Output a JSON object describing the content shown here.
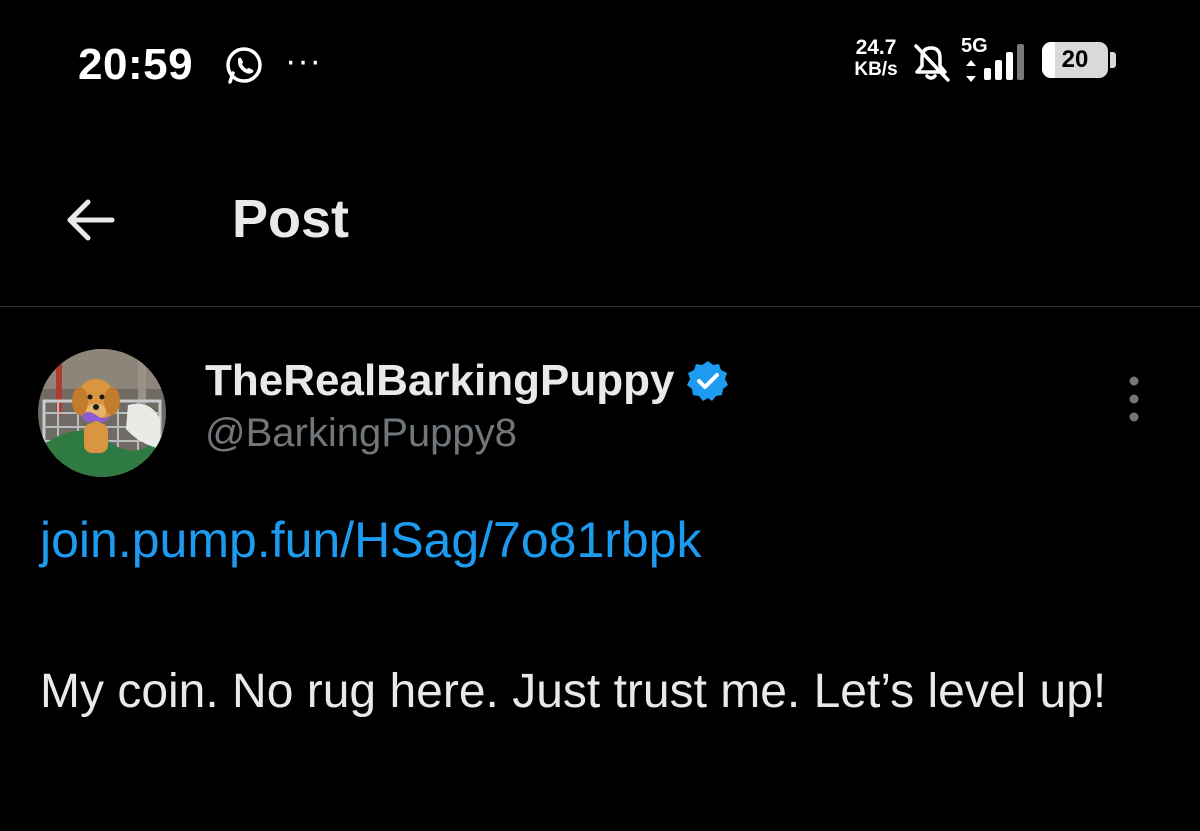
{
  "status_bar": {
    "time": "20:59",
    "more_indicator": "···",
    "net_speed_value": "24.7",
    "net_speed_unit": "KB/s",
    "network_type": "5G",
    "battery_percent": 20,
    "battery_label": "20",
    "icons": [
      "whatsapp-icon",
      "notifications-muted-icon",
      "data-arrows-icon",
      "signal-icon",
      "battery-icon"
    ]
  },
  "header": {
    "title": "Post",
    "back_icon": "arrow-left-icon"
  },
  "post": {
    "author": {
      "display_name": "TheRealBarkingPuppy",
      "handle": "@BarkingPuppy8",
      "verified": true,
      "avatar_description_icon": "avatar-puppy-photo"
    },
    "link": "join.pump.fun/HSag/7o81rbpk",
    "text": "My coin. No rug here. Just trust me. Let’s level up!",
    "more_icon": "more-vertical-icon"
  },
  "colors": {
    "background": "#000000",
    "primary_text": "#e7e9ea",
    "secondary_text": "#71767b",
    "link": "#1d9bf0",
    "verified_badge": "#1d9bf0",
    "divider": "#2f3336"
  }
}
